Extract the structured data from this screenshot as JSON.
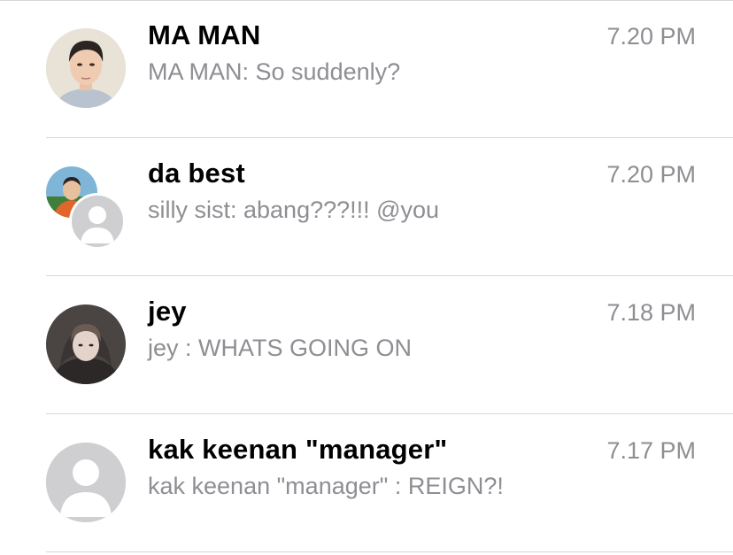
{
  "chats": [
    {
      "name": "MA MAN",
      "preview": "MA MAN: So suddenly?",
      "time": "7.20 PM",
      "avatar": "photo-avatar"
    },
    {
      "name": "da best",
      "preview": "silly sist: abang???!!! @you",
      "time": "7.20 PM",
      "avatar": "group-avatar"
    },
    {
      "name": "jey",
      "preview": "jey : WHATS GOING ON",
      "time": "7.18 PM",
      "avatar": "photo-avatar"
    },
    {
      "name": "kak keenan \"manager\"",
      "preview": "kak keenan \"manager\" : REIGN?!",
      "time": "7.17 PM",
      "avatar": "default-avatar"
    }
  ],
  "colors": {
    "name": "#000000",
    "secondary": "#8e8e93",
    "divider": "#d6d6d8",
    "placeholder_avatar": "#cfcfd1"
  }
}
